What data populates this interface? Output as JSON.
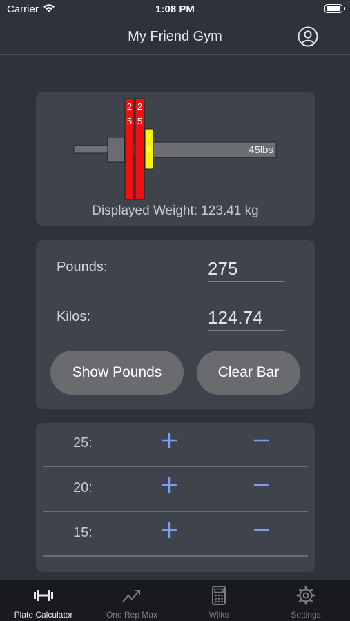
{
  "status_bar": {
    "carrier": "Carrier",
    "time": "1:08 PM"
  },
  "header": {
    "title": "My Friend Gym",
    "profile_icon": "person-circle-icon"
  },
  "barbell": {
    "bar_label": "45lbs",
    "plates": [
      {
        "label_top": "2",
        "label_bottom": "5",
        "color": "#ee1111"
      },
      {
        "label_top": "2",
        "label_bottom": "5",
        "color": "#ee1111"
      },
      {
        "label_top": "1",
        "label_bottom": "5",
        "color": "#f3f30a"
      }
    ],
    "displayed_weight": "Displayed Weight: 123.41 kg"
  },
  "converter": {
    "pounds_label": "Pounds:",
    "pounds_value": "275",
    "kilos_label": "Kilos:",
    "kilos_value": "124.74",
    "show_pounds_button": "Show Pounds",
    "clear_bar_button": "Clear Bar"
  },
  "plate_rows": [
    {
      "label": "25:"
    },
    {
      "label": "20:"
    },
    {
      "label": "15:"
    }
  ],
  "tabs": [
    {
      "label": "Plate Calculator",
      "icon": "dumbbell-icon"
    },
    {
      "label": "One Rep Max",
      "icon": "trend-chart-icon"
    },
    {
      "label": "Wilks",
      "icon": "calculator-icon"
    },
    {
      "label": "Settings",
      "icon": "gear-icon"
    }
  ],
  "colors": {
    "accent": "#7b9cf2",
    "background": "#2e323a",
    "card": "#3f434c",
    "button": "#6a6b6f"
  }
}
